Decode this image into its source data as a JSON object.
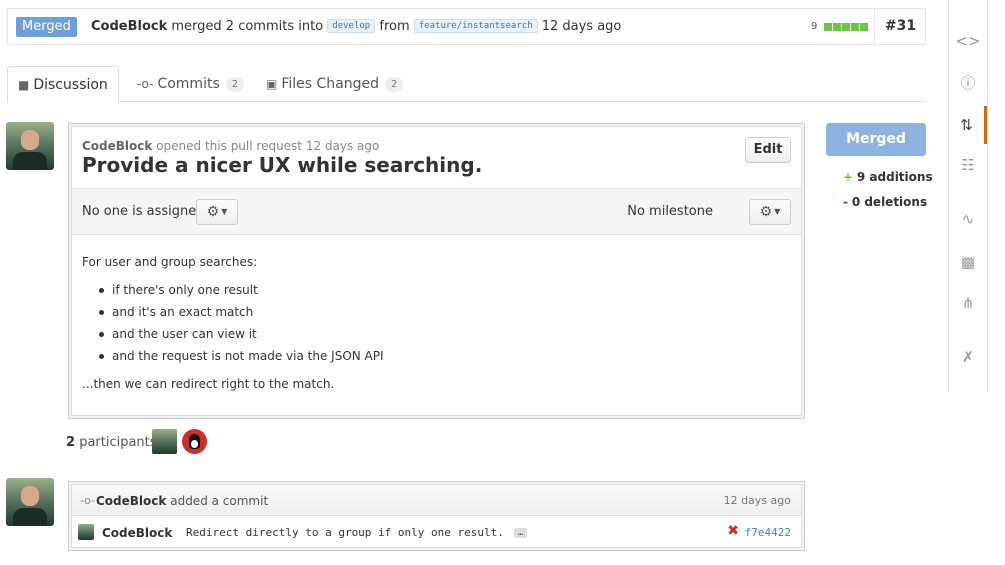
{
  "header": {
    "state": "Merged",
    "author": "CodeBlock",
    "merged_text": "merged 2 commits into",
    "base_branch": "develop",
    "from_text": "from",
    "head_branch": "feature/instantsearch",
    "time": "12 days ago",
    "diffstat_count": "9",
    "pr_number": "#31"
  },
  "tabs": [
    {
      "label": "Discussion",
      "icon": "discussion-icon"
    },
    {
      "label": "Commits",
      "icon": "commit-icon",
      "count": "2"
    },
    {
      "label": "Files Changed",
      "icon": "file-diff-icon",
      "count": "2"
    }
  ],
  "discussion": {
    "author": "CodeBlock",
    "opened_text": "opened this pull request 12 days ago",
    "title": "Provide a nicer UX while searching.",
    "edit_label": "Edit",
    "assignee_text": "No one is assigned",
    "milestone_text": "No milestone",
    "intro": "For user and group searches:",
    "bullets": [
      "if there's only one result",
      "and it's an exact match",
      "and the user can view it",
      "and the request is not made via the JSON API"
    ],
    "outro": "...then we can redirect right to the match."
  },
  "participants": {
    "count": "2",
    "label": "participants"
  },
  "commit_event": {
    "author": "CodeBlock",
    "action": "added a commit",
    "time": "12 days ago",
    "commit_author": "CodeBlock",
    "message": "Redirect directly to a group if only one result.",
    "ellipsis": "…",
    "status_mark": "✖",
    "sha": "f7e4422"
  },
  "merge_panel": {
    "button_label": "Merged",
    "additions_sign": "+",
    "additions": "9 additions",
    "deletions_sign": "-",
    "deletions": "0 deletions"
  },
  "sidebar": {
    "items": [
      "code-icon",
      "issues-icon",
      "pull-requests-icon",
      "wiki-icon",
      "pulse-icon",
      "graphs-icon",
      "network-icon",
      "settings-icon"
    ],
    "active": "pull-requests-icon"
  },
  "colors": {
    "merged_badge": "#6f9fd8",
    "merged_button": "#8fb3e0",
    "additions": "#6cc644",
    "active_sidebar": "#d26911",
    "sha_link": "#4183c4"
  }
}
